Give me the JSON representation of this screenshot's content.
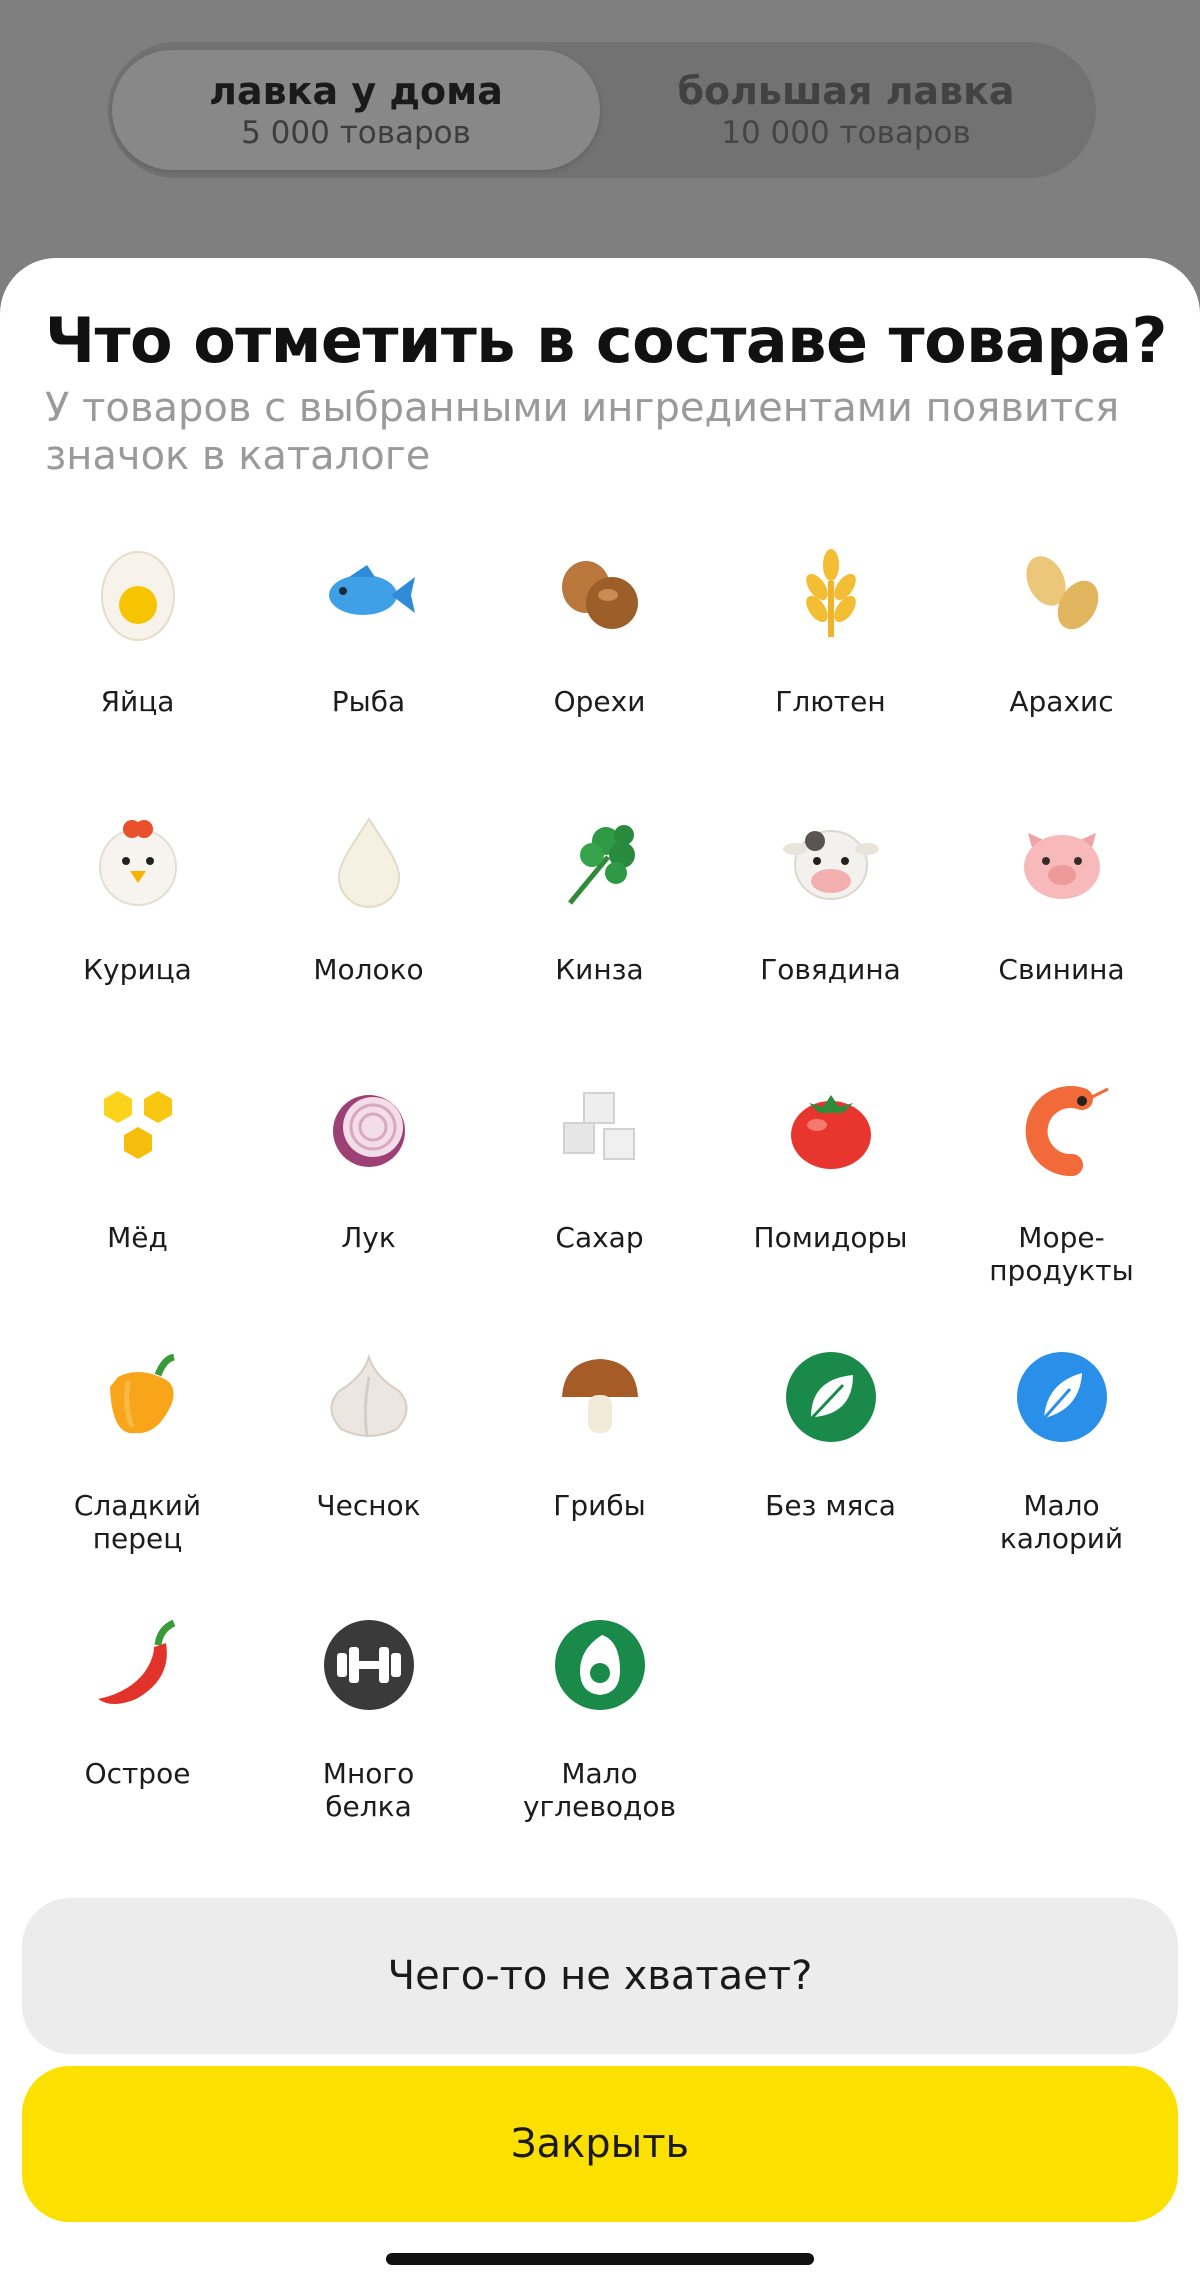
{
  "segment": {
    "tabs": [
      {
        "title": "лавка у дома",
        "subtitle": "5 000 товаров"
      },
      {
        "title": "большая лавка",
        "subtitle": "10 000 товаров"
      }
    ]
  },
  "sheet": {
    "title": "Что отметить в составе товара?",
    "subtitle": "У товаров с выбранными ингредиентами появится значок в каталоге",
    "items": [
      {
        "label": "Яйца",
        "icon": "egg-icon"
      },
      {
        "label": "Рыба",
        "icon": "fish-icon"
      },
      {
        "label": "Орехи",
        "icon": "nuts-icon"
      },
      {
        "label": "Глютен",
        "icon": "wheat-icon"
      },
      {
        "label": "Арахис",
        "icon": "peanut-icon"
      },
      {
        "label": "Курица",
        "icon": "chicken-icon"
      },
      {
        "label": "Молоко",
        "icon": "milk-drop-icon"
      },
      {
        "label": "Кинза",
        "icon": "cilantro-icon"
      },
      {
        "label": "Говядина",
        "icon": "cow-icon"
      },
      {
        "label": "Свинина",
        "icon": "pig-icon"
      },
      {
        "label": "Мёд",
        "icon": "honeycomb-icon"
      },
      {
        "label": "Лук",
        "icon": "onion-icon"
      },
      {
        "label": "Сахар",
        "icon": "sugar-cubes-icon"
      },
      {
        "label": "Помидоры",
        "icon": "tomato-icon"
      },
      {
        "label": "Море-\nпродукты",
        "icon": "shrimp-icon"
      },
      {
        "label": "Сладкий\nперец",
        "icon": "bell-pepper-icon"
      },
      {
        "label": "Чеснок",
        "icon": "garlic-icon"
      },
      {
        "label": "Грибы",
        "icon": "mushroom-icon"
      },
      {
        "label": "Без мяса",
        "icon": "leaf-badge-icon"
      },
      {
        "label": "Мало\nкалорий",
        "icon": "feather-badge-icon"
      },
      {
        "label": "Острое",
        "icon": "chili-icon"
      },
      {
        "label": "Много\nбелка",
        "icon": "dumbbell-badge-icon"
      },
      {
        "label": "Мало\nуглеводов",
        "icon": "avocado-badge-icon"
      }
    ],
    "missing_button": "Чего-то не хватает?",
    "close_button": "Закрыть"
  },
  "colors": {
    "accent": "#fce000",
    "secondary_button": "#ececec",
    "overlay": "#7f7f7f"
  }
}
